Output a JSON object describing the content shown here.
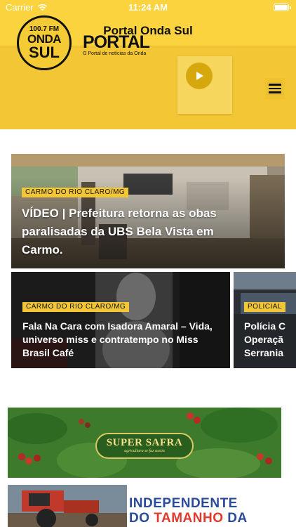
{
  "status_bar": {
    "carrier": "Carrier",
    "time": "11:24 AM"
  },
  "nav": {
    "title": "Portal Onda Sul"
  },
  "header": {
    "logo_freq": "100.7 FM",
    "logo_name_top": "ONDA",
    "logo_name_bottom": "SUL",
    "portal_word": "PORTAL",
    "portal_tagline": "O Portal de notícias da Onda"
  },
  "featured": {
    "category": "CARMO DO RIO CLARO/MG",
    "title": "VÍDEO | Prefeitura retorna as obas paralisadas da UBS Bela Vista em Carmo."
  },
  "cards": [
    {
      "category": "CARMO DO RIO CLARO/MG",
      "title": "Fala Na Cara com Isadora Amaral – Vida, universo miss e contratempo no Miss Brasil Café"
    },
    {
      "category": "POLICIAL",
      "title": "Polícia C\nOperaçã\nSerrania"
    }
  ],
  "ads": {
    "supersafra_brand": "SUPER SAFRA",
    "supersafra_slogan": "agricultura se faz assim",
    "independente_line1": "INDEPENDENTE",
    "independente_line2_a": "DO ",
    "independente_line2_b": "TAMANHO",
    "independente_line2_c": " DA"
  },
  "colors": {
    "brand_yellow": "#fad33f",
    "badge_yellow": "#f2c634"
  }
}
